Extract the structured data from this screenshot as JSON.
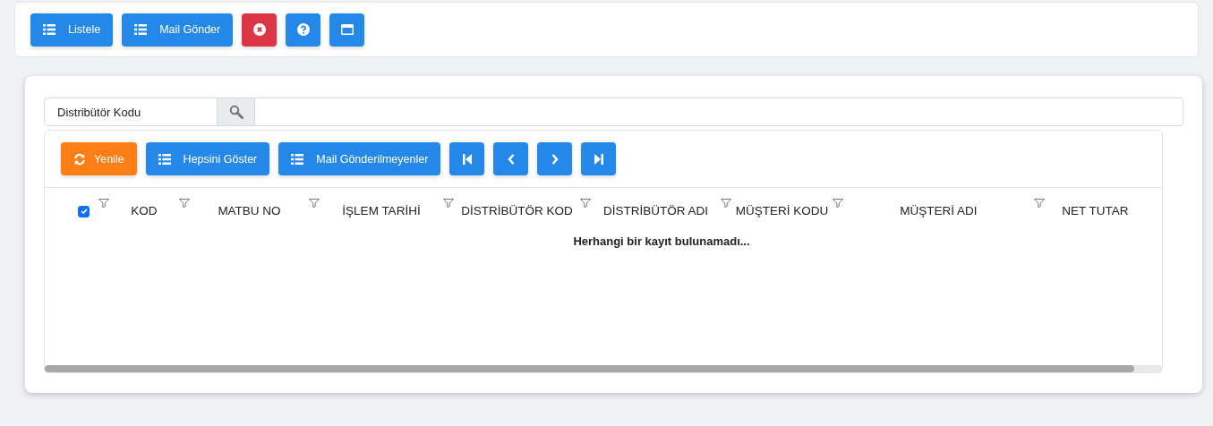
{
  "toolbar": [
    {
      "label": "Listele",
      "kind": "list"
    },
    {
      "label": "Mail Gönder",
      "kind": "list"
    },
    {
      "kind": "close"
    },
    {
      "kind": "help"
    },
    {
      "kind": "window"
    }
  ],
  "search": {
    "label": "Distribütör Kodu"
  },
  "grid_toolbar": [
    {
      "label": "Yenile",
      "kind": "refresh"
    },
    {
      "label": "Hepsini Göster",
      "kind": "list"
    },
    {
      "label": "Mail Gönderilmeyenler",
      "kind": "list"
    },
    {
      "kind": "first"
    },
    {
      "kind": "prev"
    },
    {
      "kind": "next"
    },
    {
      "kind": "last"
    }
  ],
  "table": {
    "select_all": {
      "checked": true
    },
    "columns": [
      {
        "label": "KOD"
      },
      {
        "label": "MATBU NO"
      },
      {
        "label": "İŞLEM TARİHİ"
      },
      {
        "label": "DİSTRİBÜTÖR KOD"
      },
      {
        "label": "DİSTRİBÜTÖR ADI"
      },
      {
        "label": "MÜŞTERİ KODU"
      },
      {
        "label": "MÜŞTERİ ADI"
      },
      {
        "label": "NET TUTAR"
      }
    ],
    "empty_message": "Herhangi bir kayıt bulunamadı..."
  }
}
